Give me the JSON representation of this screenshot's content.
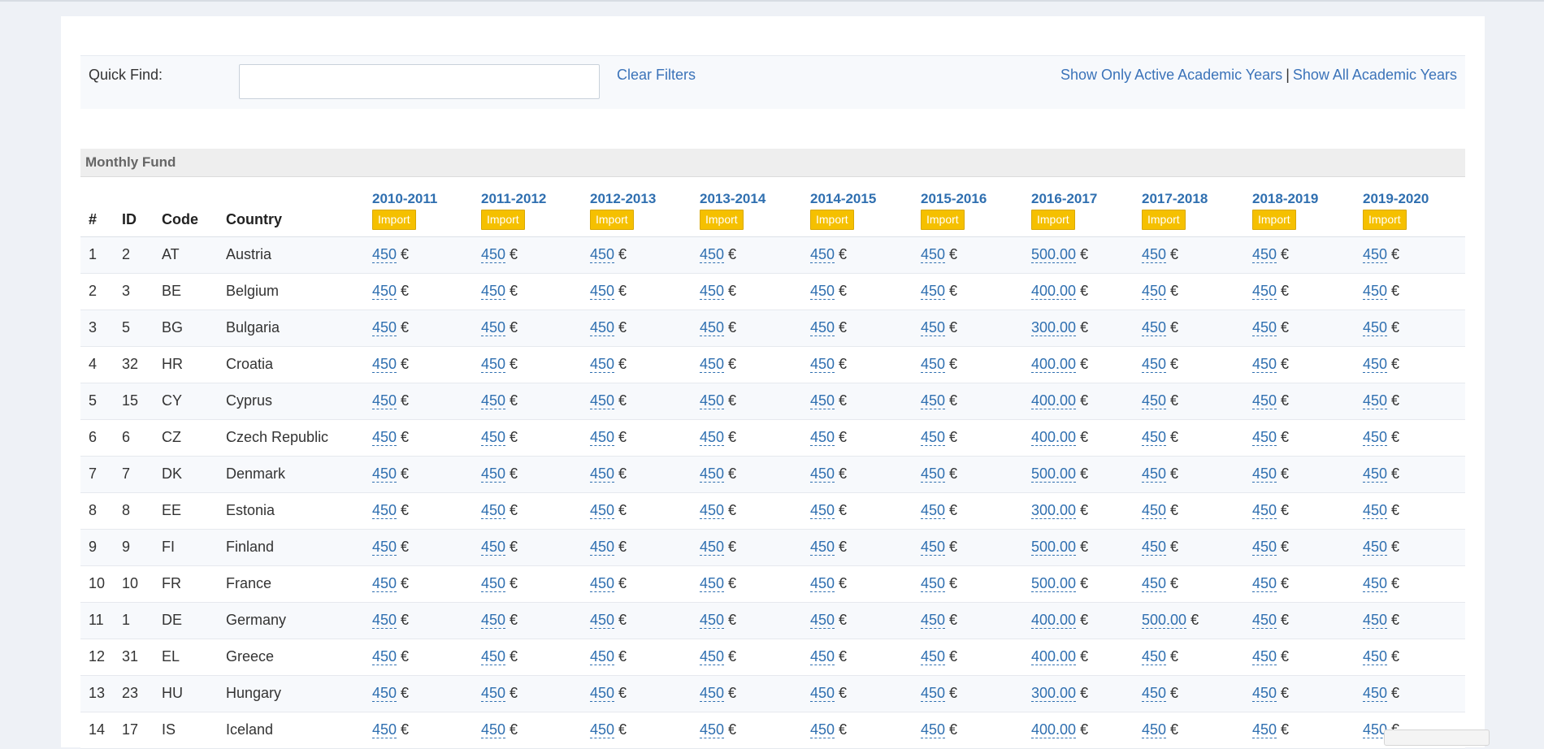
{
  "filters": {
    "quick_find_label": "Quick Find:",
    "quick_find_value": "",
    "quick_find_placeholder": "",
    "clear_filters": "Clear Filters",
    "show_active": "Show Only Active Academic Years",
    "separator": "|",
    "show_all": "Show All Academic Years"
  },
  "section_title": "Monthly Fund",
  "columns": {
    "num": "#",
    "id": "ID",
    "code": "Code",
    "country": "Country",
    "import_label": "Import",
    "years": [
      "2010-2011",
      "2011-2012",
      "2012-2013",
      "2013-2014",
      "2014-2015",
      "2015-2016",
      "2016-2017",
      "2017-2018",
      "2018-2019",
      "2019-2020"
    ]
  },
  "currency": "€",
  "rows": [
    {
      "num": "1",
      "id": "2",
      "code": "AT",
      "country": "Austria",
      "values": [
        "450",
        "450",
        "450",
        "450",
        "450",
        "450",
        "500.00",
        "450",
        "450",
        "450"
      ]
    },
    {
      "num": "2",
      "id": "3",
      "code": "BE",
      "country": "Belgium",
      "values": [
        "450",
        "450",
        "450",
        "450",
        "450",
        "450",
        "400.00",
        "450",
        "450",
        "450"
      ]
    },
    {
      "num": "3",
      "id": "5",
      "code": "BG",
      "country": "Bulgaria",
      "values": [
        "450",
        "450",
        "450",
        "450",
        "450",
        "450",
        "300.00",
        "450",
        "450",
        "450"
      ]
    },
    {
      "num": "4",
      "id": "32",
      "code": "HR",
      "country": "Croatia",
      "values": [
        "450",
        "450",
        "450",
        "450",
        "450",
        "450",
        "400.00",
        "450",
        "450",
        "450"
      ]
    },
    {
      "num": "5",
      "id": "15",
      "code": "CY",
      "country": "Cyprus",
      "values": [
        "450",
        "450",
        "450",
        "450",
        "450",
        "450",
        "400.00",
        "450",
        "450",
        "450"
      ]
    },
    {
      "num": "6",
      "id": "6",
      "code": "CZ",
      "country": "Czech Republic",
      "values": [
        "450",
        "450",
        "450",
        "450",
        "450",
        "450",
        "400.00",
        "450",
        "450",
        "450"
      ]
    },
    {
      "num": "7",
      "id": "7",
      "code": "DK",
      "country": "Denmark",
      "values": [
        "450",
        "450",
        "450",
        "450",
        "450",
        "450",
        "500.00",
        "450",
        "450",
        "450"
      ]
    },
    {
      "num": "8",
      "id": "8",
      "code": "EE",
      "country": "Estonia",
      "values": [
        "450",
        "450",
        "450",
        "450",
        "450",
        "450",
        "300.00",
        "450",
        "450",
        "450"
      ]
    },
    {
      "num": "9",
      "id": "9",
      "code": "FI",
      "country": "Finland",
      "values": [
        "450",
        "450",
        "450",
        "450",
        "450",
        "450",
        "500.00",
        "450",
        "450",
        "450"
      ]
    },
    {
      "num": "10",
      "id": "10",
      "code": "FR",
      "country": "France",
      "values": [
        "450",
        "450",
        "450",
        "450",
        "450",
        "450",
        "500.00",
        "450",
        "450",
        "450"
      ]
    },
    {
      "num": "11",
      "id": "1",
      "code": "DE",
      "country": "Germany",
      "values": [
        "450",
        "450",
        "450",
        "450",
        "450",
        "450",
        "400.00",
        "500.00",
        "450",
        "450"
      ]
    },
    {
      "num": "12",
      "id": "31",
      "code": "EL",
      "country": "Greece",
      "values": [
        "450",
        "450",
        "450",
        "450",
        "450",
        "450",
        "400.00",
        "450",
        "450",
        "450"
      ]
    },
    {
      "num": "13",
      "id": "23",
      "code": "HU",
      "country": "Hungary",
      "values": [
        "450",
        "450",
        "450",
        "450",
        "450",
        "450",
        "300.00",
        "450",
        "450",
        "450"
      ]
    },
    {
      "num": "14",
      "id": "17",
      "code": "IS",
      "country": "Iceland",
      "values": [
        "450",
        "450",
        "450",
        "450",
        "450",
        "450",
        "400.00",
        "450",
        "450",
        "450"
      ]
    }
  ]
}
